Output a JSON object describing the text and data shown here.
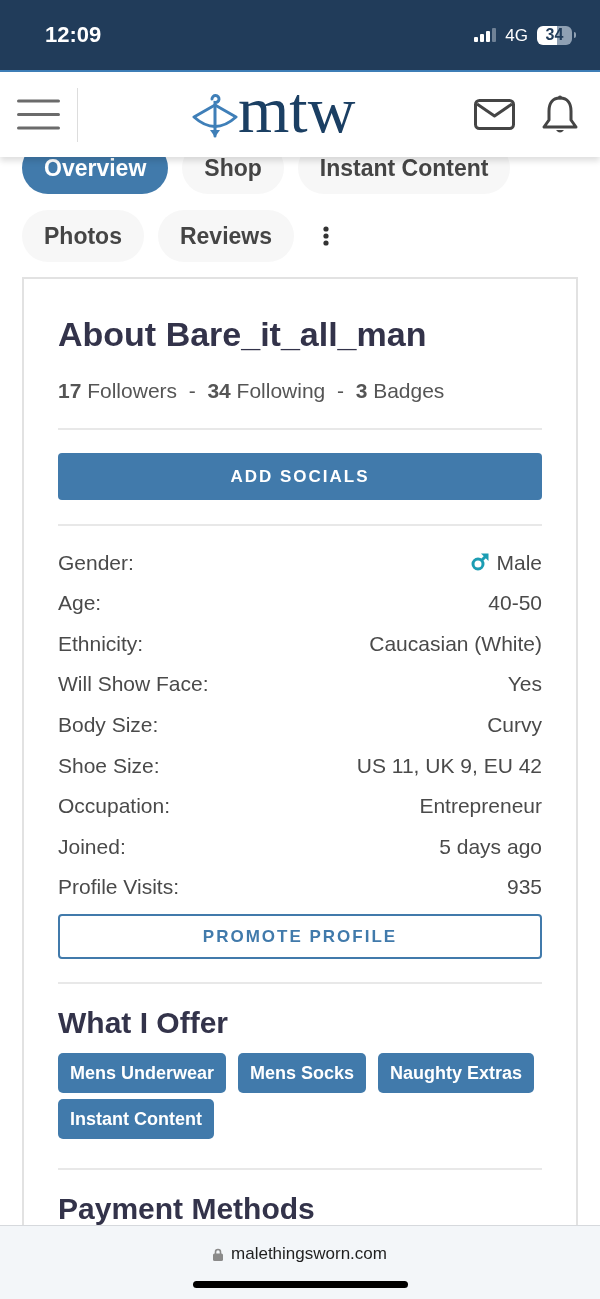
{
  "status_bar": {
    "time": "12:09",
    "network": "4G",
    "battery": "34"
  },
  "header": {
    "logo": "mtw"
  },
  "tabs": [
    {
      "label": "Overview",
      "selected": true
    },
    {
      "label": "Shop",
      "selected": false
    },
    {
      "label": "Instant Content",
      "selected": false
    },
    {
      "label": "Photos",
      "selected": false
    },
    {
      "label": "Reviews",
      "selected": false
    }
  ],
  "about": {
    "title": "About Bare_it_all_man",
    "stats": "**17** Followers  -  **34** Following  -  **3** Badges",
    "add_socials_button": "ADD SOCIALS",
    "details": [
      {
        "kind": "gender",
        "label": "Gender:",
        "value": "Male"
      },
      {
        "kind": "text",
        "label": "Age:",
        "value": "40-50"
      },
      {
        "kind": "text",
        "label": "Ethnicity:",
        "value": "Caucasian (White)"
      },
      {
        "kind": "text",
        "label": "Will Show Face:",
        "value": "Yes"
      },
      {
        "kind": "text",
        "label": "Body Size:",
        "value": "Curvy"
      },
      {
        "kind": "text",
        "label": "Shoe Size:",
        "value": "US 11, UK 9, EU 42"
      },
      {
        "kind": "text",
        "label": "Occupation:",
        "value": "Entrepreneur"
      },
      {
        "kind": "text",
        "label": "Joined:",
        "value": "5 days ago"
      },
      {
        "kind": "text",
        "label": "Profile Visits:",
        "value": "935"
      }
    ],
    "promote_button": "PROMOTE PROFILE"
  },
  "offers": {
    "title": "What I Offer",
    "tags": [
      "Mens Underwear",
      "Mens Socks",
      "Naughty Extras",
      "Instant Content"
    ]
  },
  "payment_methods": {
    "title": "Payment Methods"
  },
  "browser_bar": {
    "url": "malethingsworn.com"
  }
}
